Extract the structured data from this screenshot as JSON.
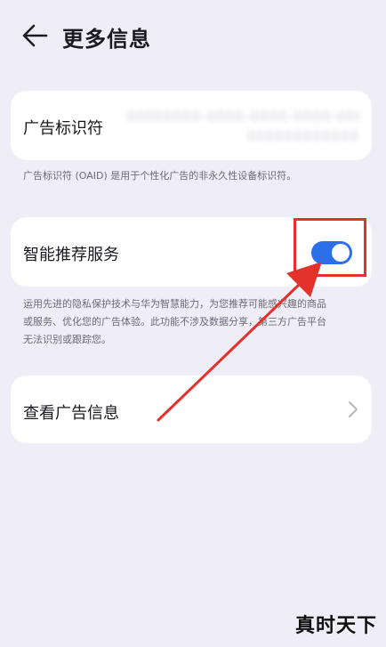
{
  "header": {
    "back_icon": "back-arrow-icon",
    "title": "更多信息"
  },
  "oaid_card": {
    "label": "广告标识符",
    "value_lines": [
      "00000000-0000-0000-0000-000",
      "000000000000"
    ]
  },
  "oaid_note": "广告标识符 (OAID) 是用于个性化广告的非永久性设备标识符。",
  "recommend_card": {
    "label": "智能推荐服务",
    "toggle_on": true
  },
  "recommend_note": {
    "line1": "运用先进的隐私保护技术与华为智慧能力，为您推荐可能感兴趣的商品",
    "line2": "或服务、优化您的广告体验。此功能不涉及数据分享，第三方广告平台",
    "line3": "无法识别或跟踪您。"
  },
  "adinfo_card": {
    "label": "查看广告信息",
    "chevron_icon": "chevron-right-icon"
  },
  "annotation": {
    "color": "#e4312c"
  },
  "watermark": "真时天下",
  "colors": {
    "background": "#efedf6",
    "accent": "#2d6fe8"
  }
}
